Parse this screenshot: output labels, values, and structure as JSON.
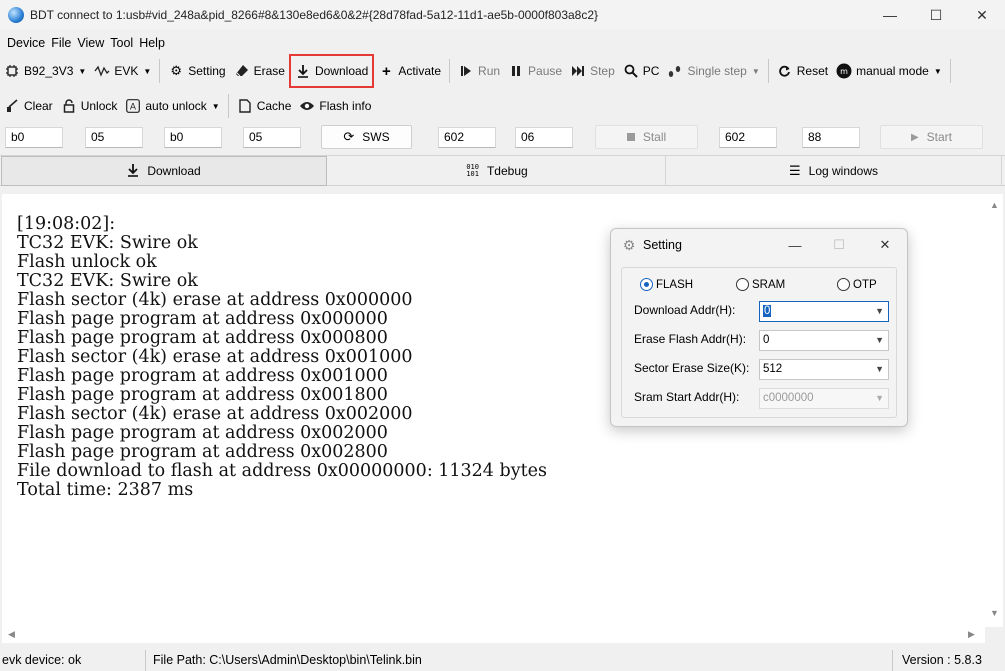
{
  "window": {
    "title": "BDT connect to 1:usb#vid_248a&pid_8266#8&130e8ed6&0&2#{28d78fad-5a12-11d1-ae5b-0000f803a8c2}",
    "min": "—",
    "max": "☐",
    "close": "✕"
  },
  "menu": [
    "Device",
    "File",
    "View",
    "Tool",
    "Help"
  ],
  "toolbar1": {
    "chip": "B92_3V3",
    "board": "EVK",
    "setting": "Setting",
    "erase": "Erase",
    "download": "Download",
    "activate": "Activate",
    "run": "Run",
    "pause": "Pause",
    "step": "Step",
    "pc": "PC",
    "single_step": "Single step",
    "reset": "Reset",
    "mode": "manual mode"
  },
  "toolbar2": {
    "clear": "Clear",
    "unlock": "Unlock",
    "auto_unlock": "auto unlock",
    "cache": "Cache",
    "flash_info": "Flash info"
  },
  "fields": {
    "f1": "b0",
    "f2": "05",
    "f3": "b0",
    "f4": "05",
    "sws": "SWS",
    "f5": "602",
    "f6": "06",
    "stall": "Stall",
    "f7": "602",
    "f8": "88",
    "start": "Start"
  },
  "tabs": {
    "download": "Download",
    "tdebug": "Tdebug",
    "log": "Log windows"
  },
  "log_text": "[19:08:02]:\nTC32 EVK: Swire ok\nFlash unlock ok\nTC32 EVK: Swire ok\nFlash sector (4k) erase at address 0x000000\nFlash page program at address 0x000000\nFlash page program at address 0x000800\nFlash sector (4k) erase at address 0x001000\nFlash page program at address 0x001000\nFlash page program at address 0x001800\nFlash sector (4k) erase at address 0x002000\nFlash page program at address 0x002000\nFlash page program at address 0x002800\nFile download to flash at address 0x00000000: 11324 bytes\nTotal time: 2387 ms",
  "status": {
    "device": "evk device: ok",
    "file_path": "File Path:  C:\\Users\\Admin\\Desktop\\bin\\Telink.bin",
    "version": "Version : 5.8.3"
  },
  "dialog": {
    "title": "Setting",
    "radio_flash": "FLASH",
    "radio_sram": "SRAM",
    "radio_otp": "OTP",
    "download_addr_label": "Download  Addr(H):",
    "download_addr_value": "0",
    "erase_addr_label": "Erase Flash Addr(H):",
    "erase_addr_value": "0",
    "sector_size_label": "Sector Erase Size(K):",
    "sector_size_value": "512",
    "sram_addr_label": "Sram Start Addr(H):",
    "sram_addr_value": "c0000000"
  },
  "colors": {
    "highlight": "#e53935",
    "accent": "#1565c0"
  }
}
